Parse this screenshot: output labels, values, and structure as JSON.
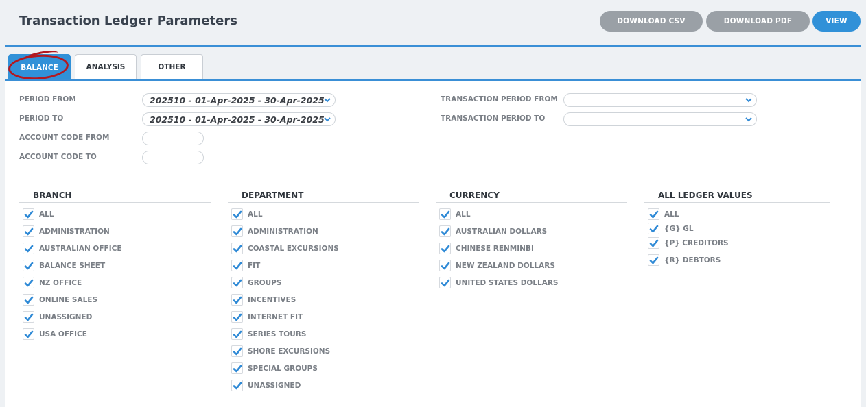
{
  "header": {
    "title": "Transaction Ledger Parameters",
    "buttons": {
      "download_csv": "DOWNLOAD CSV",
      "download_pdf": "DOWNLOAD PDF",
      "view": "VIEW"
    }
  },
  "tabs": {
    "balance": "BALANCE",
    "analysis": "ANALYSIS",
    "other": "OTHER",
    "active": "BALANCE"
  },
  "filters": {
    "period_from": {
      "label": "PERIOD FROM",
      "value": "202510 - 01-Apr-2025 - 30-Apr-2025"
    },
    "period_to": {
      "label": "PERIOD TO",
      "value": "202510 - 01-Apr-2025 - 30-Apr-2025"
    },
    "account_code_from": {
      "label": "ACCOUNT CODE FROM",
      "value": ""
    },
    "account_code_to": {
      "label": "ACCOUNT CODE TO",
      "value": ""
    },
    "transaction_period_from": {
      "label": "TRANSACTION PERIOD FROM",
      "value": ""
    },
    "transaction_period_to": {
      "label": "TRANSACTION PERIOD TO",
      "value": ""
    }
  },
  "groups": {
    "branch": {
      "title": "BRANCH",
      "items": [
        "ALL",
        "ADMINISTRATION",
        "AUSTRALIAN OFFICE",
        "BALANCE SHEET",
        "NZ OFFICE",
        "ONLINE SALES",
        "UNASSIGNED",
        "USA OFFICE"
      ]
    },
    "department": {
      "title": "DEPARTMENT",
      "items": [
        "ALL",
        "ADMINISTRATION",
        "COASTAL EXCURSIONS",
        "FIT",
        "GROUPS",
        "INCENTIVES",
        "INTERNET FIT",
        "SERIES TOURS",
        "SHORE EXCURSIONS",
        "SPECIAL GROUPS",
        "UNASSIGNED"
      ]
    },
    "currency": {
      "title": "CURRENCY",
      "items": [
        "ALL",
        "AUSTRALIAN DOLLARS",
        "CHINESE RENMINBI",
        "NEW ZEALAND DOLLARS",
        "UNITED STATES DOLLARS"
      ]
    },
    "ledger": {
      "title": "ALL LEDGER VALUES",
      "items": [
        "ALL",
        "{G} GL",
        "{P} CREDITORS",
        "{R} DEBTORS"
      ]
    }
  },
  "icons": {
    "checkbox": "checkmark-icon",
    "dropdown": "chevron-down-icon"
  },
  "colors": {
    "accent": "#3191d8",
    "secondary_button": "#9aa0a6",
    "annotation": "#b3181f",
    "check": "#2f8ad6"
  }
}
